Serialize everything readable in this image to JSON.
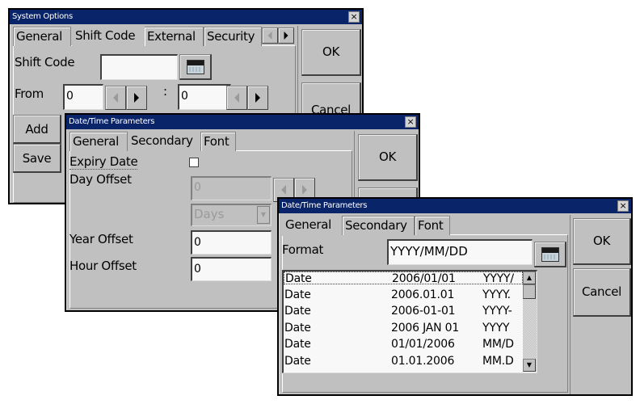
{
  "system_options": {
    "title": "System Options",
    "close": "×",
    "tabs": [
      "General",
      "Shift Code",
      "External",
      "Security"
    ],
    "active_tab": "Shift Code",
    "shift_code_label": "Shift Code",
    "shift_code_value": "",
    "from_label": "From",
    "from_hour": "0",
    "colon": ":",
    "from_minute": "0",
    "ok": "OK",
    "cancel": "Cancel",
    "add": "Add",
    "save": "Save"
  },
  "dt_secondary": {
    "title": "Date/Time Parameters",
    "close": "×",
    "tabs": [
      "General",
      "Secondary",
      "Font"
    ],
    "active_tab": "Secondary",
    "expiry_label": "Expiry Date",
    "expiry_checked": false,
    "day_offset_label": "Day Offset",
    "day_offset_value": "0",
    "unit_value": "Days",
    "year_offset_label": "Year Offset",
    "year_offset_value": "0",
    "hour_offset_label": "Hour Offset",
    "hour_offset_value": "0",
    "ok": "OK"
  },
  "dt_general": {
    "title": "Date/Time Parameters",
    "close": "×",
    "tabs": [
      "General",
      "Secondary",
      "Font"
    ],
    "active_tab": "General",
    "format_label": "Format",
    "format_value": "YYYY/MM/DD",
    "ok": "OK",
    "cancel": "Cancel",
    "formats": [
      {
        "type": "Date",
        "example": "2006/01/01",
        "pattern": "YYYY/"
      },
      {
        "type": "Date",
        "example": "2006.01.01",
        "pattern": "YYYY."
      },
      {
        "type": "Date",
        "example": "2006-01-01",
        "pattern": "YYYY-"
      },
      {
        "type": "Date",
        "example": "2006 JAN 01",
        "pattern": "YYYY "
      },
      {
        "type": "Date",
        "example": "01/01/2006",
        "pattern": "MM/D"
      },
      {
        "type": "Date",
        "example": "01.01.2006",
        "pattern": "MM.D"
      }
    ]
  }
}
